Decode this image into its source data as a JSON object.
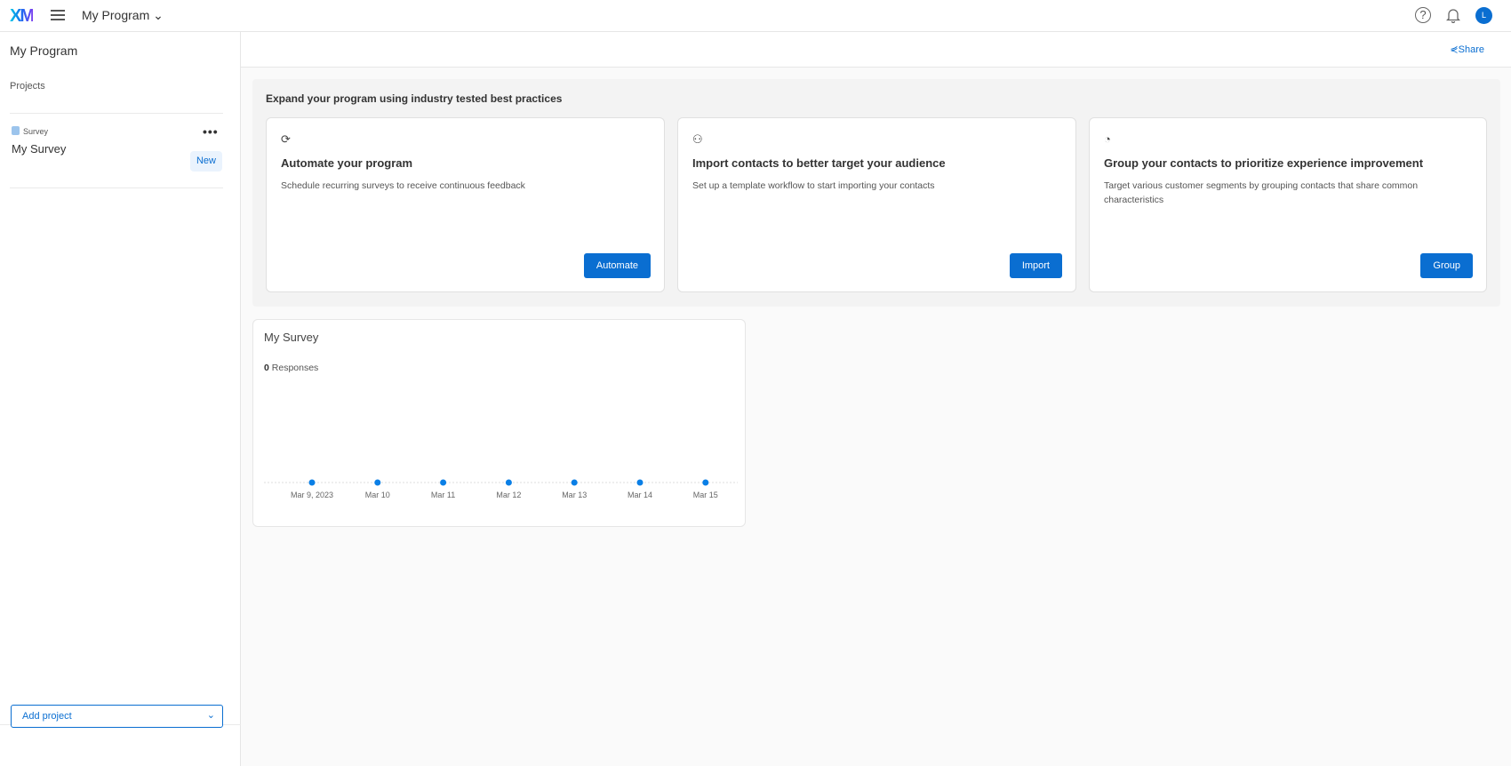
{
  "topbar": {
    "logo": "XM",
    "program": "My Program",
    "avatar": "L"
  },
  "sidebar": {
    "title": "My Program",
    "projects_label": "Projects",
    "project": {
      "type": "Survey",
      "name": "My Survey",
      "badge": "New"
    },
    "add_project": "Add project"
  },
  "share": "Share",
  "best_practices": {
    "heading": "Expand your program using industry tested best practices",
    "cards": [
      {
        "title": "Automate your program",
        "desc": "Schedule recurring surveys to receive continuous feedback",
        "button": "Automate",
        "icon": "automate-icon"
      },
      {
        "title": "Import contacts to better target your audience",
        "desc": "Set up a template workflow to start importing your contacts",
        "button": "Import",
        "icon": "contacts-icon"
      },
      {
        "title": "Group your contacts to prioritize experience improvement",
        "desc": "Target various customer segments by grouping contacts that share common characteristics",
        "button": "Group",
        "icon": "group-icon"
      }
    ]
  },
  "survey_widget": {
    "title": "My Survey",
    "responses_count": "0",
    "responses_label": "Responses"
  },
  "chart_data": {
    "type": "line",
    "categories": [
      "Mar 9, 2023",
      "Mar 10",
      "Mar 11",
      "Mar 12",
      "Mar 13",
      "Mar 14",
      "Mar 15"
    ],
    "values": [
      0,
      0,
      0,
      0,
      0,
      0,
      0
    ],
    "color": "#0a7fe6"
  }
}
